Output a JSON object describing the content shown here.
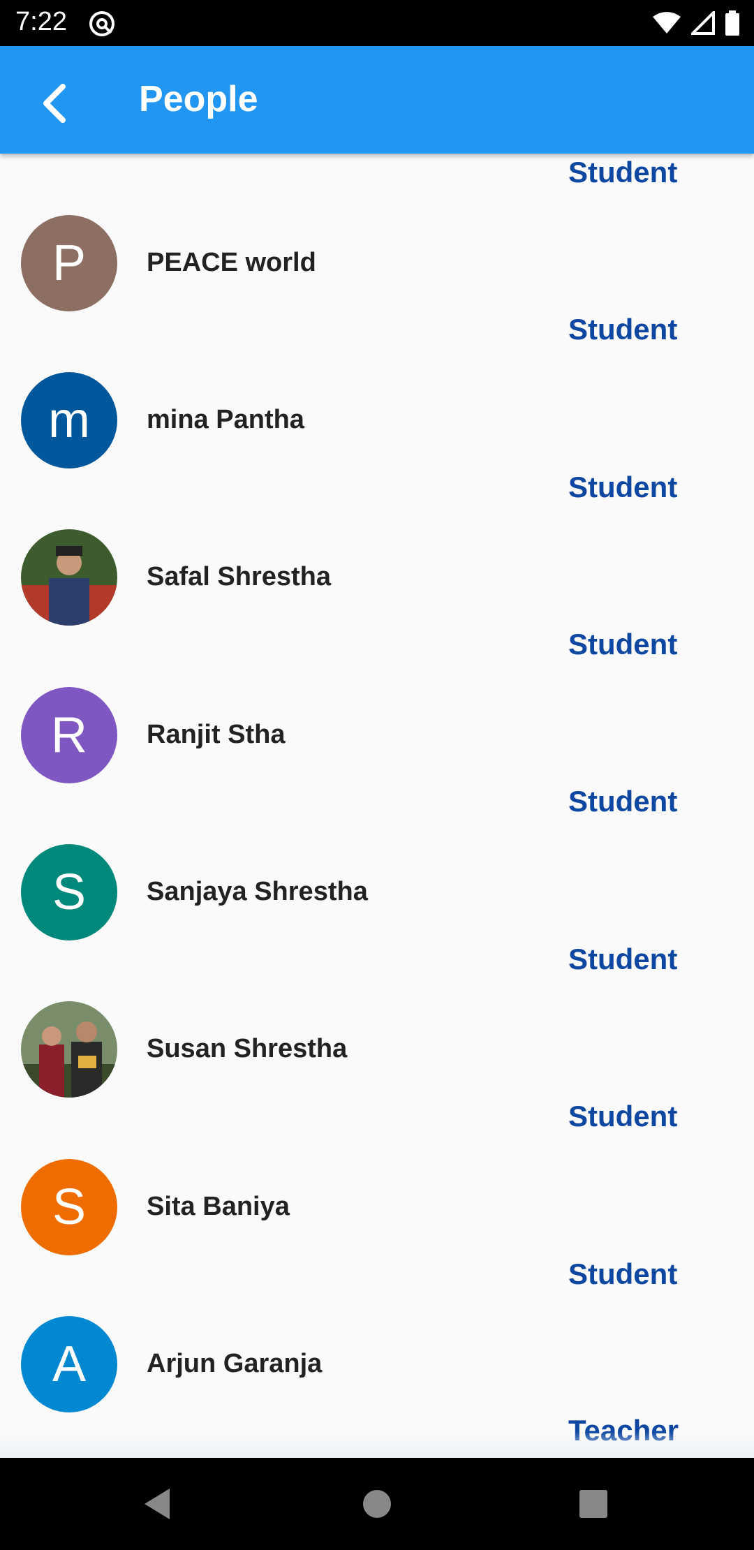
{
  "status_bar": {
    "time": "7:22"
  },
  "app_bar": {
    "title": "People"
  },
  "colors": {
    "primary": "#2196f3",
    "role_text": "#0d47a1"
  },
  "people": [
    {
      "role": "Student",
      "name": "PEACE world",
      "avatar_letter": "P",
      "avatar_color": "#8d6e63",
      "avatar_type": "letter"
    },
    {
      "role": "Student",
      "name": "mina Pantha",
      "avatar_letter": "m",
      "avatar_color": "#01579b",
      "avatar_type": "letter"
    },
    {
      "role": "Student",
      "name": "Safal Shrestha",
      "avatar_letter": "",
      "avatar_color": "#4a6b3a",
      "avatar_type": "photo"
    },
    {
      "role": "Student",
      "name": "Ranjit Stha",
      "avatar_letter": "R",
      "avatar_color": "#7e57c2",
      "avatar_type": "letter"
    },
    {
      "role": "Student",
      "name": "Sanjaya Shrestha",
      "avatar_letter": "S",
      "avatar_color": "#00897b",
      "avatar_type": "letter"
    },
    {
      "role": "Student",
      "name": "Susan Shrestha",
      "avatar_letter": "",
      "avatar_color": "#5a4a3a",
      "avatar_type": "photo"
    },
    {
      "role": "Student",
      "name": "Sita Baniya",
      "avatar_letter": "S",
      "avatar_color": "#ef6c00",
      "avatar_type": "letter"
    },
    {
      "role": "Student",
      "name": "Arjun Garanja",
      "avatar_letter": "A",
      "avatar_color": "#0288d1",
      "avatar_type": "letter"
    }
  ],
  "trailing_role": "Teacher"
}
